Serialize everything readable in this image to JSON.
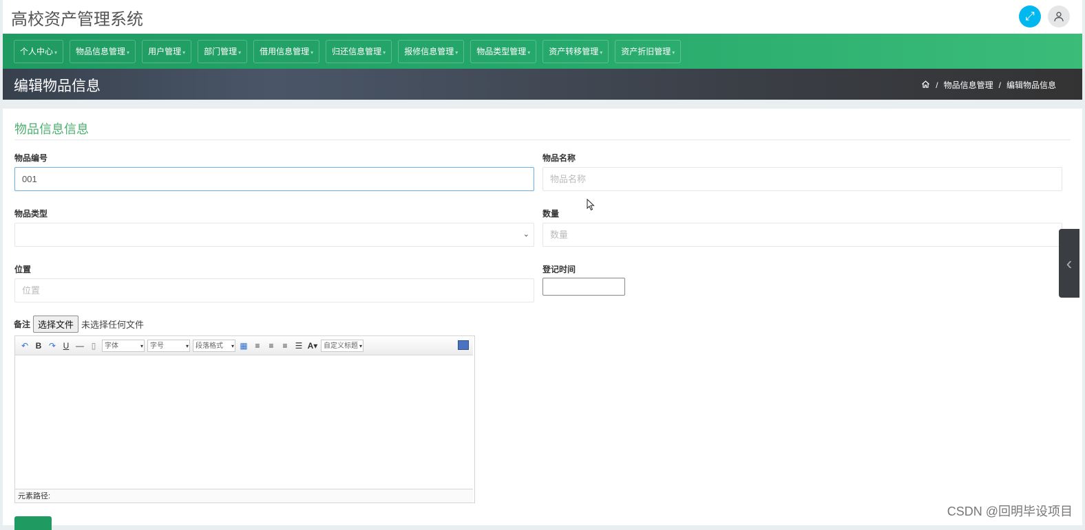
{
  "app": {
    "title": "高校资产管理系统",
    "expand_icon": "expand-icon",
    "user_icon": "user-icon",
    "accent": "#00b7ee"
  },
  "nav": {
    "color": "#25a86b",
    "items": [
      {
        "label": "个人中心"
      },
      {
        "label": "物品信息管理"
      },
      {
        "label": "用户管理"
      },
      {
        "label": "部门管理"
      },
      {
        "label": "借用信息管理"
      },
      {
        "label": "归还信息管理"
      },
      {
        "label": "报修信息管理"
      },
      {
        "label": "物品类型管理"
      },
      {
        "label": "资产转移管理"
      },
      {
        "label": "资产折旧管理"
      }
    ]
  },
  "header": {
    "title": "编辑物品信息",
    "breadcrumb": [
      "物品信息管理",
      "编辑物品信息"
    ],
    "separator": "/"
  },
  "form": {
    "section_title": "物品信息信息",
    "fields": {
      "item_no": {
        "label": "物品编号",
        "value": "001"
      },
      "item_name": {
        "label": "物品名称",
        "placeholder": "物品名称"
      },
      "item_type": {
        "label": "物品类型",
        "value": ""
      },
      "quantity": {
        "label": "数量",
        "placeholder": "数量"
      },
      "location": {
        "label": "位置",
        "placeholder": "位置"
      },
      "reg_time": {
        "label": "登记时间",
        "value": ""
      }
    },
    "remarks": {
      "label": "备注",
      "file_button": "选择文件",
      "file_status": "未选择任何文件",
      "toolbar": {
        "font": "字体",
        "size": "字号",
        "paragraph": "段落格式",
        "custom_title": "自定义标题"
      },
      "status_path": "元素路径:"
    }
  },
  "watermark": "CSDN @回明毕设项目"
}
